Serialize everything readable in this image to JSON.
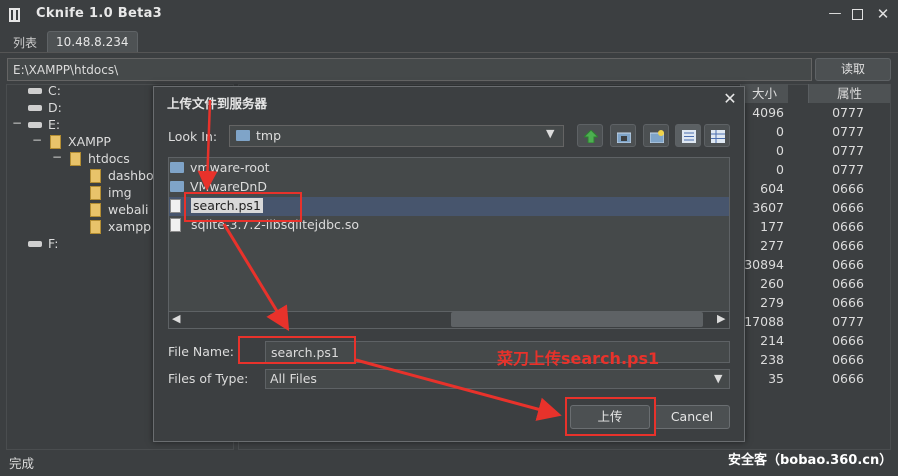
{
  "window": {
    "title": "Cknife 1.0 Beta3",
    "min": "—",
    "close": "✕"
  },
  "tabs": [
    {
      "label": "列表"
    },
    {
      "label": "10.48.8.234"
    }
  ],
  "path_bar": {
    "path": "E:\\XAMPP\\htdocs\\",
    "read_label": "读取"
  },
  "tree": {
    "drive_c": "C:",
    "drive_d": "D:",
    "drive_e": "E:",
    "drive_f": "F:",
    "xampp": "XAMPP",
    "htdocs": "htdocs",
    "children": [
      "dashbo",
      "img",
      "webali",
      "xampp"
    ],
    "toggle_open": "−"
  },
  "table": {
    "col_size": "大小",
    "col_attr": "属性",
    "rows": [
      {
        "size": "4096",
        "attr": "0777"
      },
      {
        "size": "0",
        "attr": "0777"
      },
      {
        "size": "0",
        "attr": "0777"
      },
      {
        "size": "0",
        "attr": "0777"
      },
      {
        "size": "604",
        "attr": "0666"
      },
      {
        "size": "3607",
        "attr": "0666"
      },
      {
        "size": "177",
        "attr": "0666"
      },
      {
        "size": "277",
        "attr": "0666"
      },
      {
        "size": "30894",
        "attr": "0666"
      },
      {
        "size": "260",
        "attr": "0666"
      },
      {
        "size": "279",
        "attr": "0666"
      },
      {
        "size": "17088",
        "attr": "0777"
      },
      {
        "size": "214",
        "attr": "0666"
      },
      {
        "size": "238",
        "attr": "0666"
      },
      {
        "size": "35",
        "attr": "0666"
      }
    ]
  },
  "status": {
    "text": "完成",
    "watermark": "安全客（bobao.360.cn）"
  },
  "dialog": {
    "title": "上传文件到服务器",
    "close": "✕",
    "look_in_label": "Look In:",
    "look_in_value": "tmp",
    "files": [
      {
        "name": "vmware-root",
        "type": "folder"
      },
      {
        "name": "VMwareDnD",
        "type": "folder"
      },
      {
        "name": "search.ps1",
        "type": "file",
        "selected": true
      },
      {
        "name": "sqlite-3.7.2-libsqlitejdbc.so",
        "type": "file"
      }
    ],
    "file_name_label": "File Name:",
    "file_name_value": "search.ps1",
    "files_of_type_label": "Files of Type:",
    "files_of_type_value": "All Files",
    "upload_label": "上传",
    "cancel_label": "Cancel",
    "scroll_left": "◀",
    "scroll_right": "▶",
    "dropdown_arrow": "▼"
  },
  "annotation": {
    "caption": "菜刀上传search.ps1",
    "color": "#e8322b"
  },
  "icons": {
    "up_folder": "up-folder-icon",
    "home": "home-icon",
    "new_folder": "new-folder-icon",
    "list_view": "list-view-icon",
    "details_view": "details-view-icon"
  }
}
